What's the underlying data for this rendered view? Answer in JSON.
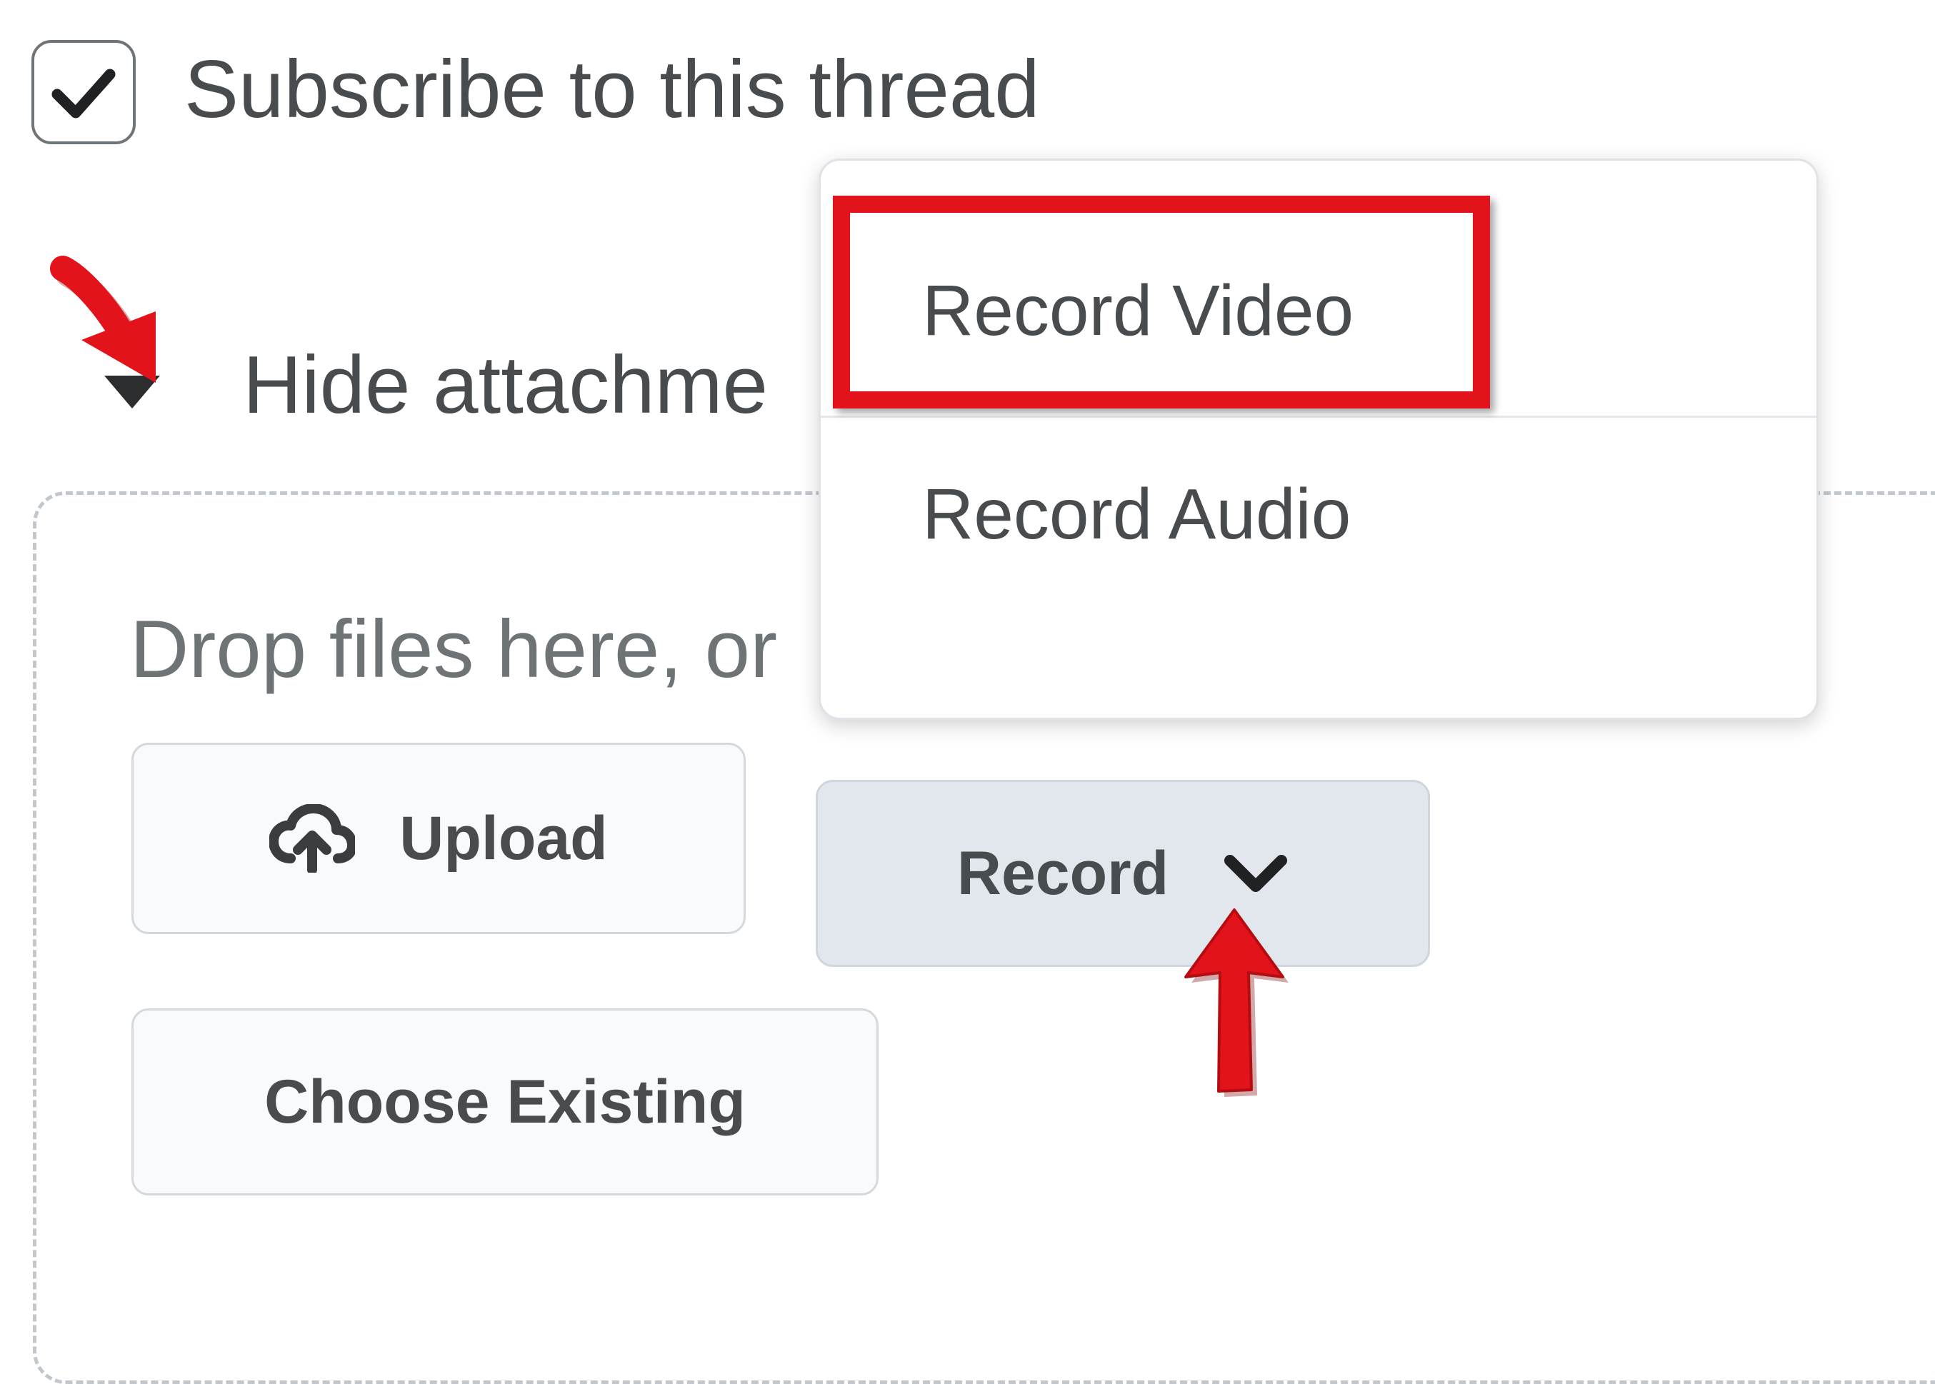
{
  "subscribe": {
    "label": "Subscribe to this thread",
    "checked": true
  },
  "attachments": {
    "toggle_label": "Hide attachme",
    "drop_hint": "Drop files here, or"
  },
  "buttons": {
    "upload_label": "Upload",
    "record_label": "Record",
    "choose_existing_label": "Choose Existing"
  },
  "record_menu": {
    "items": [
      {
        "label": "Record Video",
        "highlighted": true
      },
      {
        "label": "Record Audio",
        "highlighted": false
      }
    ]
  },
  "icons": {
    "checkbox": "checkmark-icon",
    "toggle": "caret-down-icon",
    "upload": "cloud-upload-icon",
    "record_dropdown": "chevron-down-icon"
  },
  "colors": {
    "annotation": "#e3131b",
    "text": "#494c4e",
    "record_button_bg": "#e2e7ee",
    "dropzone_border": "#c1c7cc"
  }
}
